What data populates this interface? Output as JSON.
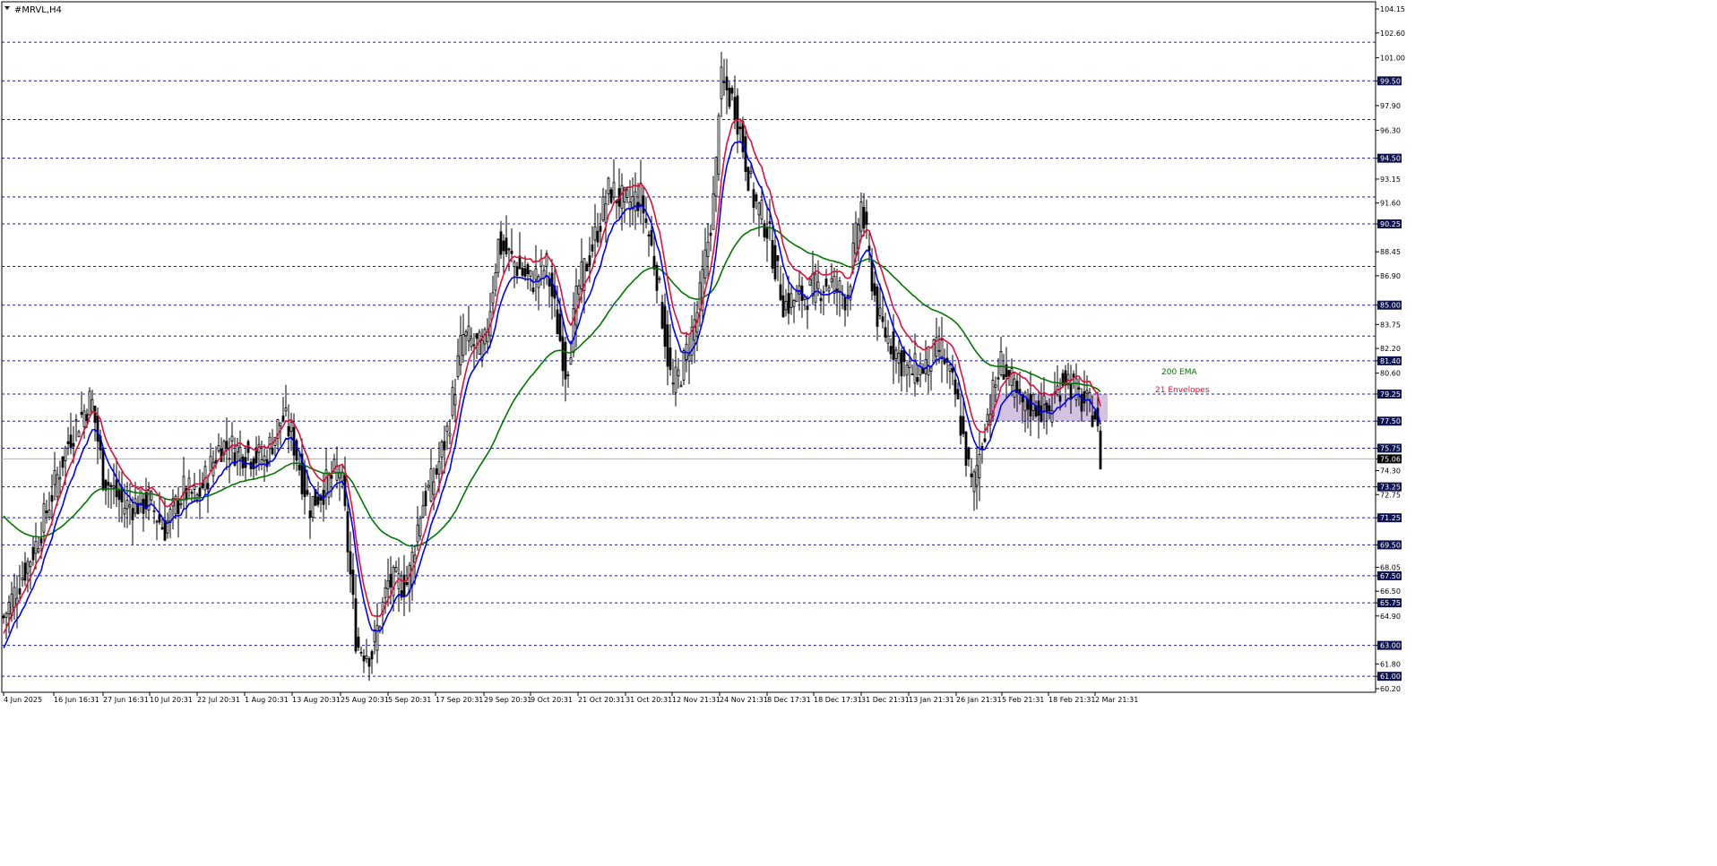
{
  "window": {
    "title": "#MRVL,H4"
  },
  "chart_data": {
    "type": "candlestick",
    "symbol": "#MRVL",
    "timeframe": "H4",
    "y_range": [
      60.2,
      104.15
    ],
    "grid": false,
    "price_ticks": [
      "104.15",
      "102.60",
      "101.00",
      "99.50",
      "97.90",
      "96.30",
      "94.50",
      "93.15",
      "91.60",
      "90.25",
      "88.45",
      "86.90",
      "85.00",
      "83.75",
      "82.20",
      "81.40",
      "80.60",
      "79.25",
      "77.50",
      "75.75",
      "75.06",
      "74.30",
      "73.25",
      "72.75",
      "71.25",
      "69.50",
      "68.05",
      "67.50",
      "66.50",
      "65.75",
      "64.90",
      "63.00",
      "61.80",
      "61.00",
      "60.20"
    ],
    "highlighted_levels": [
      "102.00",
      "99.50",
      "97.00",
      "94.50",
      "92.00",
      "90.25",
      "87.50",
      "85.00",
      "83.00",
      "81.40",
      "79.25",
      "77.50",
      "75.75",
      "73.25",
      "71.25",
      "69.50",
      "67.50",
      "65.75",
      "63.00",
      "61.00"
    ],
    "current_price": "75.06",
    "x_tick_labels": [
      "4 Jun 2025",
      "16 Jun 16:31",
      "27 Jun 16:31",
      "10 Jul 20:31",
      "22 Jul 20:31",
      "1 Aug 20:31",
      "13 Aug 20:31",
      "25 Aug 20:31",
      "5 Sep 20:31",
      "17 Sep 20:31",
      "29 Sep 20:31",
      "9 Oct 20:31",
      "21 Oct 20:31",
      "31 Oct 20:31",
      "12 Nov 21:31",
      "24 Nov 21:31",
      "8 Dec 17:31",
      "18 Dec 17:31",
      "31 Dec 21:31",
      "13 Jan 21:31",
      "26 Jan 21:31",
      "5 Feb 21:31",
      "18 Feb 21:31",
      "2 Mar 21:31"
    ],
    "anchor_series": [
      {
        "date": "4 Jun 2025",
        "price": 64.8
      },
      {
        "date": "12 Jun",
        "price": 69.5
      },
      {
        "date": "18 Jun",
        "price": 76.5
      },
      {
        "date": "22 Jun",
        "price": 79.0
      },
      {
        "date": "27 Jun 16:31",
        "price": 74.0
      },
      {
        "date": "3 Jul",
        "price": 72.0
      },
      {
        "date": "10 Jul 20:31",
        "price": 72.3
      },
      {
        "date": "14 Jul",
        "price": 70.5
      },
      {
        "date": "18 Jul",
        "price": 73.0
      },
      {
        "date": "22 Jul 20:31",
        "price": 72.5
      },
      {
        "date": "28 Jul",
        "price": 76.0
      },
      {
        "date": "1 Aug 20:31",
        "price": 75.5
      },
      {
        "date": "6 Aug",
        "price": 75.0
      },
      {
        "date": "10 Aug",
        "price": 77.8
      },
      {
        "date": "13 Aug 20:31",
        "price": 76.5
      },
      {
        "date": "18 Aug",
        "price": 72.0
      },
      {
        "date": "22 Aug",
        "price": 73.5
      },
      {
        "date": "25 Aug 20:31",
        "price": 74.5
      },
      {
        "date": "29 Aug",
        "price": 63.0
      },
      {
        "date": "2 Sep",
        "price": 62.5
      },
      {
        "date": "5 Sep 20:31",
        "price": 67.0
      },
      {
        "date": "10 Sep",
        "price": 67.0
      },
      {
        "date": "14 Sep",
        "price": 72.0
      },
      {
        "date": "17 Sep 20:31",
        "price": 74.0
      },
      {
        "date": "20 Sep",
        "price": 77.0
      },
      {
        "date": "25 Sep",
        "price": 83.0
      },
      {
        "date": "29 Sep 20:31",
        "price": 82.0
      },
      {
        "date": "2 Oct",
        "price": 89.0
      },
      {
        "date": "5 Oct",
        "price": 88.0
      },
      {
        "date": "9 Oct 20:31",
        "price": 86.5
      },
      {
        "date": "13 Oct",
        "price": 87.5
      },
      {
        "date": "17 Oct",
        "price": 80.6
      },
      {
        "date": "21 Oct 20:31",
        "price": 86.0
      },
      {
        "date": "25 Oct",
        "price": 89.0
      },
      {
        "date": "28 Oct",
        "price": 92.5
      },
      {
        "date": "31 Oct 20:31",
        "price": 91.5
      },
      {
        "date": "4 Nov",
        "price": 92.0
      },
      {
        "date": "8 Nov",
        "price": 87.0
      },
      {
        "date": "12 Nov 21:31",
        "price": 79.5
      },
      {
        "date": "15 Nov",
        "price": 81.0
      },
      {
        "date": "19 Nov",
        "price": 85.0
      },
      {
        "date": "22 Nov",
        "price": 92.5
      },
      {
        "date": "24 Nov 21:31",
        "price": 99.5
      },
      {
        "date": "27 Nov",
        "price": 98.0
      },
      {
        "date": "3 Dec",
        "price": 92.0
      },
      {
        "date": "8 Dec 17:31",
        "price": 90.0
      },
      {
        "date": "12 Dec",
        "price": 85.0
      },
      {
        "date": "18 Dec 17:31",
        "price": 86.0
      },
      {
        "date": "24 Dec",
        "price": 86.5
      },
      {
        "date": "28 Dec",
        "price": 85.5
      },
      {
        "date": "31 Dec 21:31",
        "price": 91.5
      },
      {
        "date": "5 Jan",
        "price": 84.0
      },
      {
        "date": "9 Jan",
        "price": 82.5
      },
      {
        "date": "13 Jan 21:31",
        "price": 80.6
      },
      {
        "date": "17 Jan",
        "price": 81.0
      },
      {
        "date": "22 Jan",
        "price": 82.2
      },
      {
        "date": "26 Jan 21:31",
        "price": 79.0
      },
      {
        "date": "30 Jan",
        "price": 73.0
      },
      {
        "date": "2 Feb",
        "price": 77.5
      },
      {
        "date": "5 Feb 21:31",
        "price": 81.4
      },
      {
        "date": "10 Feb",
        "price": 78.5
      },
      {
        "date": "14 Feb",
        "price": 78.6
      },
      {
        "date": "18 Feb 21:31",
        "price": 78.0
      },
      {
        "date": "22 Feb",
        "price": 80.6
      },
      {
        "date": "26 Feb",
        "price": 79.0
      },
      {
        "date": "2 Mar 21:31",
        "price": 78.0
      },
      {
        "date": "4 Mar",
        "price": 75.06
      }
    ],
    "indicators": [
      {
        "name": "200 EMA",
        "color": "#007700"
      },
      {
        "name": "21 Envelopes",
        "color": "#e0103a",
        "lower_color": "#0000ff"
      }
    ],
    "colors": {
      "background": "#ffffff",
      "candle": "#000000",
      "grid_dash": "#1c1c8c",
      "level_label_bg": "#0d1450",
      "level_label_text": "#ffffff",
      "zone_fill": "#c8b4d8",
      "current_price_bg": "#000000"
    },
    "zone": {
      "price_top": 79.25,
      "price_bottom": 77.5,
      "start_date": "4 Feb",
      "end_date": "4 Mar"
    }
  }
}
